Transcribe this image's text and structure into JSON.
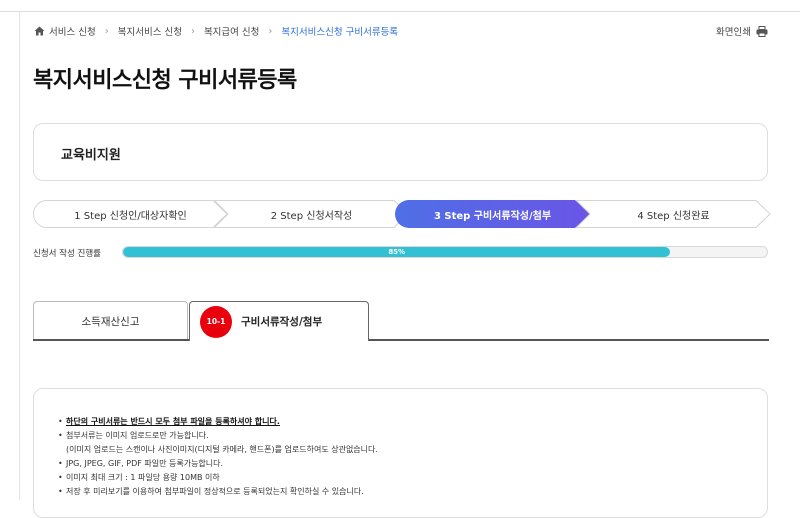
{
  "breadcrumb": {
    "items": [
      "서비스 신청",
      "복지서비스 신청",
      "복지급여 신청"
    ],
    "current": "복지서비스신청 구비서류등록"
  },
  "print_label": "화면인쇄",
  "page_title": "복지서비스신청 구비서류등록",
  "service_name": "교육비지원",
  "steps": [
    {
      "label": "1 Step 신청인/대상자확인",
      "active": false
    },
    {
      "label": "2 Step 신청서작성",
      "active": false
    },
    {
      "label": "3 Step 구비서류작성/첨부",
      "active": true
    },
    {
      "label": "4 Step 신청완료",
      "active": false
    }
  ],
  "progress": {
    "label": "신청서 작성 진행률",
    "value_text": "85%",
    "value": 0.85
  },
  "tabs": [
    {
      "label": "소득재산신고"
    },
    {
      "badge": "10-1",
      "label": "구비서류작성/첨부"
    }
  ],
  "notices": [
    "하단의 구비서류는 반드시 모두 첨부 파일을 등록하셔야 합니다.",
    "첨부서류는 이미지 업로드로만 가능합니다.",
    "(이미지 업로드는 스캔이나 사진이미지(디지털 카메라, 핸드폰)를 업로드하여도 상관없습니다.",
    "JPG, JPEG, GIF, PDF 파일만 등록가능합니다.",
    "이미지 최대 크기 : 1 파일당 용량 10MB 이하",
    "저장 후 미리보기를 이용하여 첨부파일이 정상적으로 등록되었는지 확인하실 수 있습니다."
  ],
  "colors": {
    "accent_step": "#5b63e6",
    "progress_fill": "#32c1d4",
    "badge": "#e8000c",
    "link": "#2f6fd6"
  }
}
